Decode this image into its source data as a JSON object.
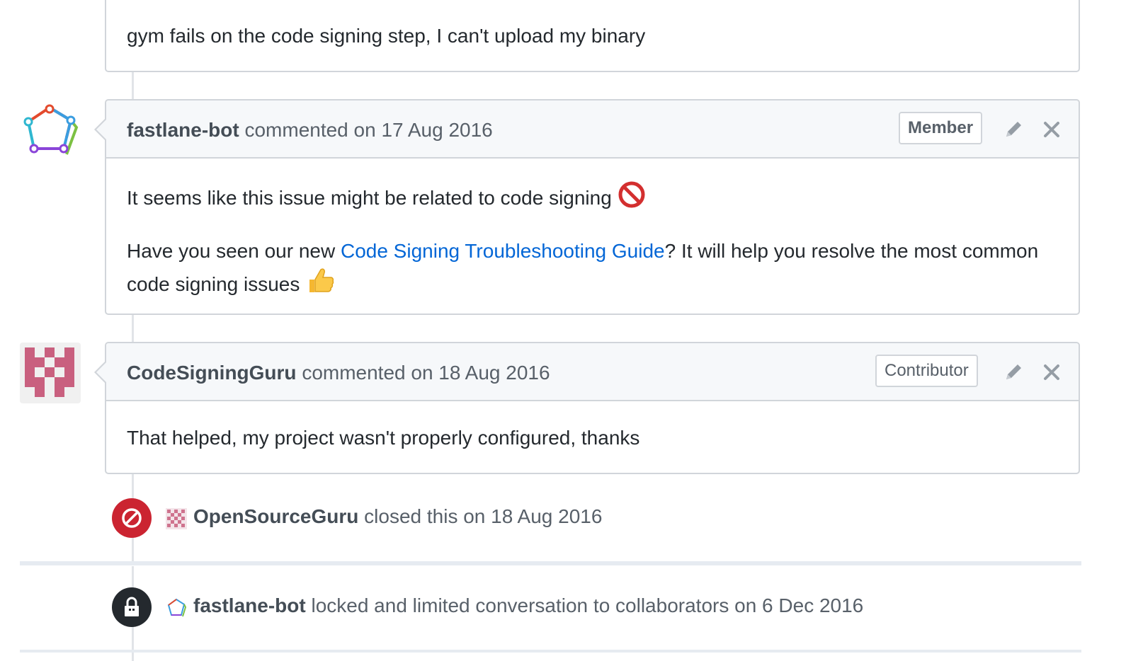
{
  "issue_body": {
    "text": "gym fails on the code signing step, I can't upload my binary"
  },
  "comments": [
    {
      "author": "fastlane-bot",
      "meta": "commented on 17 Aug 2016",
      "role": "Member",
      "paragraph1": "It seems like this issue might be related to code signing",
      "paragraph2_before": "Have you seen our new ",
      "paragraph2_link": "Code Signing Troubleshooting Guide",
      "paragraph2_after": "? It will help you resolve the most common code signing issues"
    },
    {
      "author": "CodeSigningGuru",
      "meta": "commented on 18 Aug 2016",
      "role": "Contributor",
      "paragraph1": "That helped, my project wasn't properly configured, thanks"
    }
  ],
  "events": [
    {
      "type": "closed",
      "author": "OpenSourceGuru",
      "text": "closed this on 18 Aug 2016",
      "color": "#cb2431"
    },
    {
      "type": "locked",
      "author": "fastlane-bot",
      "text": "locked and limited conversation to collaborators on 6 Dec 2016",
      "color": "#24292e"
    }
  ],
  "colors": {
    "link": "#0366d6",
    "border": "#d1d5da",
    "header_bg": "#f6f8fa",
    "identicon": "#c9607f"
  },
  "icons": {
    "edit": "pencil-icon",
    "close": "x-icon",
    "closed_event": "circle-slash-icon",
    "locked_event": "lock-icon",
    "no_entry_emoji": "no-entry-sign-emoji",
    "thumbs_up_emoji": "thumbs-up-emoji"
  }
}
